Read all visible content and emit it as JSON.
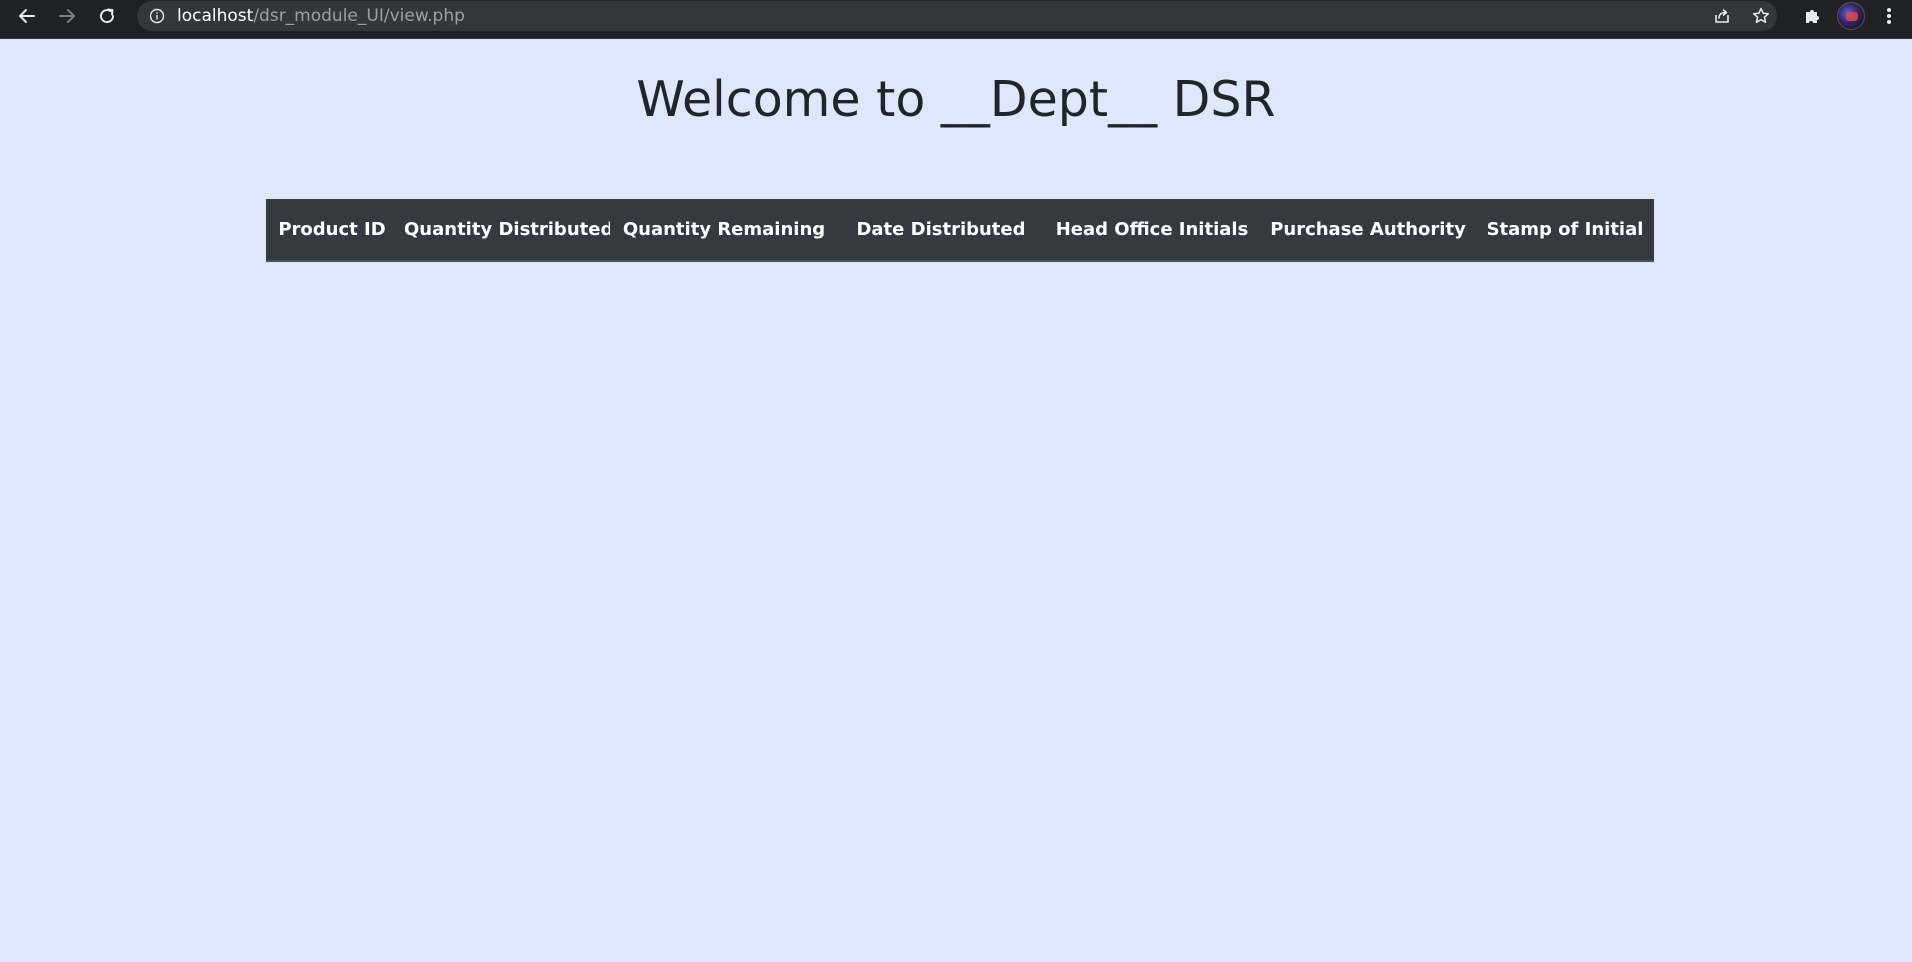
{
  "browser": {
    "url_host": "localhost",
    "url_path": "/dsr_module_UI/view.php"
  },
  "page": {
    "title": "Welcome to __Dept__ DSR"
  },
  "table": {
    "columns": [
      "Product ID",
      "Quantity Distributed",
      "Quantity Remaining",
      "Date Distributed",
      "Head Office Initials",
      "Purchase Authority",
      "Stamp of Initial"
    ],
    "rows": []
  },
  "colors": {
    "page_background": "#dde8fe",
    "table_header_background": "#343a40",
    "browser_chrome": "#202124"
  },
  "icons": {
    "back": "arrow-left-icon",
    "forward": "arrow-right-icon",
    "reload": "reload-icon",
    "site_info": "info-icon",
    "share": "share-icon",
    "bookmark": "star-icon",
    "extensions": "puzzle-icon",
    "menu": "kebab-menu-icon"
  }
}
